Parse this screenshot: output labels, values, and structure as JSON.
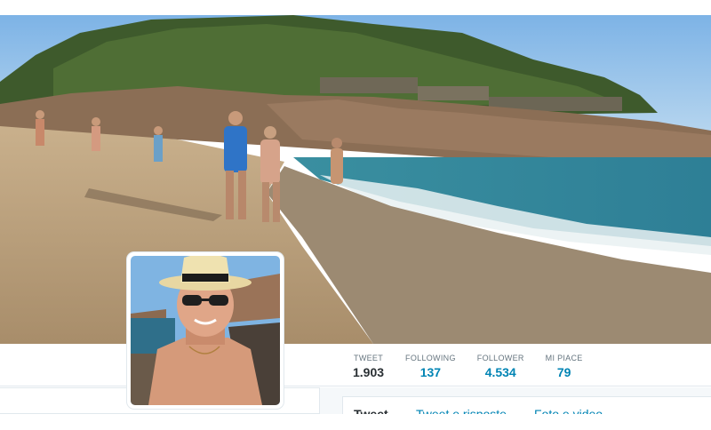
{
  "profile": {
    "stats": [
      {
        "label": "TWEET",
        "value": "1.903",
        "active": true
      },
      {
        "label": "FOLLOWING",
        "value": "137",
        "active": false
      },
      {
        "label": "FOLLOWER",
        "value": "4.534",
        "active": false
      },
      {
        "label": "MI PIACE",
        "value": "79",
        "active": false
      }
    ],
    "tabs": [
      "Tweet",
      "Tweet e risposte",
      "Foto e video"
    ]
  },
  "colors": {
    "link": "#0084b4",
    "text": "#292f33",
    "muted": "#66757f",
    "border": "#e1e8ed",
    "background": "#f5f8fa"
  },
  "images": {
    "header": "beach-header-photo",
    "avatar": "profile-avatar-photo"
  }
}
